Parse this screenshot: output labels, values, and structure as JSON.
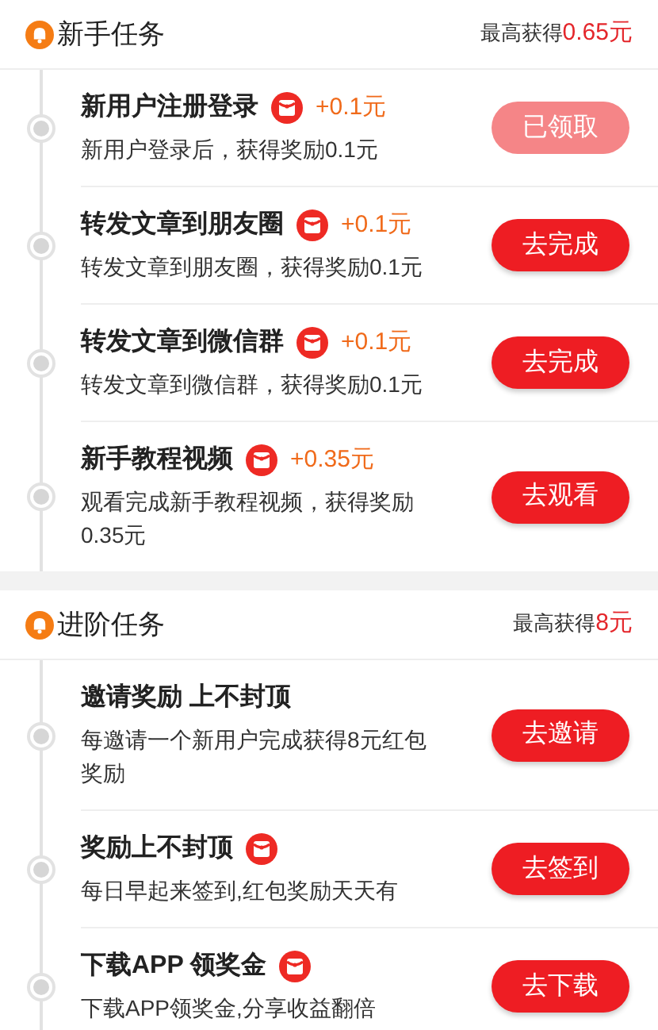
{
  "sections": [
    {
      "title": "新手任务",
      "max_label": "最高获得",
      "max_value": "0.65元",
      "tasks": [
        {
          "title": "新用户注册登录",
          "red_packet": true,
          "reward": "+0.1元",
          "desc": "新用户登录后，获得奖励0.1元",
          "button": "已领取",
          "disabled": true
        },
        {
          "title": "转发文章到朋友圈",
          "red_packet": true,
          "reward": "+0.1元",
          "desc": "转发文章到朋友圈，获得奖励0.1元",
          "button": "去完成",
          "disabled": false
        },
        {
          "title": "转发文章到微信群",
          "red_packet": true,
          "reward": "+0.1元",
          "desc": "转发文章到微信群，获得奖励0.1元",
          "button": "去完成",
          "disabled": false
        },
        {
          "title": "新手教程视频",
          "red_packet": true,
          "reward": "+0.35元",
          "desc": "观看完成新手教程视频，获得奖励0.35元",
          "button": "去观看",
          "disabled": false
        }
      ]
    },
    {
      "title": "进阶任务",
      "max_label": "最高获得",
      "max_value": "8元",
      "tasks": [
        {
          "title": "邀请奖励 上不封顶",
          "red_packet": false,
          "desc": "每邀请一个新用户完成获得8元红包奖励",
          "button": "去邀请",
          "disabled": false
        },
        {
          "title": "奖励上不封顶",
          "red_packet": true,
          "desc": "每日早起来签到,红包奖励天天有",
          "button": "去签到",
          "disabled": false
        },
        {
          "title": "下载APP 领奖金",
          "red_packet": true,
          "desc": "下载APP领奖金,分享收益翻倍",
          "button": "去下载",
          "disabled": false
        }
      ]
    }
  ]
}
